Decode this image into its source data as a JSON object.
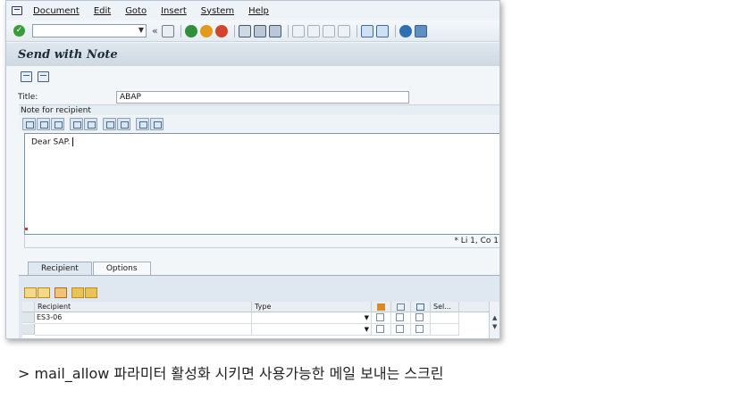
{
  "menu": {
    "items": [
      {
        "label": "Document"
      },
      {
        "label": "Edit"
      },
      {
        "label": "Goto"
      },
      {
        "label": "Insert"
      },
      {
        "label": "System"
      },
      {
        "label": "Help"
      }
    ]
  },
  "toolbar": {
    "command_field_value": "",
    "back_glyph": "«"
  },
  "screen": {
    "title": "Send with Note"
  },
  "form": {
    "title_label": "Title:",
    "title_value": "ABAP"
  },
  "note": {
    "header": "Note for recipient",
    "text": "Dear SAP.",
    "status": "*  Li 1, Co 1"
  },
  "tabs": [
    {
      "label": "Recipient",
      "active": true
    },
    {
      "label": "Options",
      "active": false
    }
  ],
  "recipients": {
    "columns": {
      "recipient": "Recipient",
      "type": "Type",
      "sel": "Sel..."
    },
    "rows": [
      {
        "recipient": "ES3-06",
        "type": ""
      },
      {
        "recipient": "",
        "type": ""
      }
    ]
  },
  "caption": "> mail_allow 파라미터 활성화 시키면 사용가능한 메일 보내는 스크린",
  "colors": {
    "accent_blue": "#3f5f85",
    "ok_green": "#3a9b3a",
    "title_bar": "#cfd9e2"
  }
}
